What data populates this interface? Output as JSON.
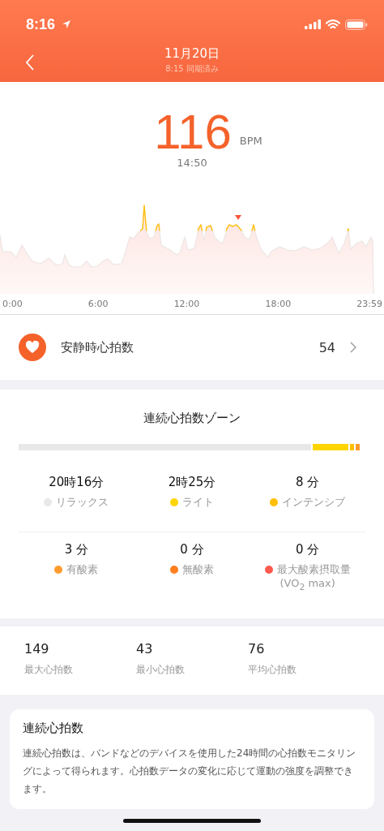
{
  "status_bar": {
    "time": "8:16"
  },
  "nav": {
    "title": "11月20日",
    "subtitle": "8:15 同期済み"
  },
  "current": {
    "value": "116",
    "unit": "BPM",
    "time": "14:50"
  },
  "graph": {
    "axis_labels": [
      "0:00",
      "6:00",
      "12:00",
      "18:00",
      "23:59"
    ]
  },
  "resting": {
    "label": "安静時心拍数",
    "value": "54"
  },
  "zones": {
    "title": "連続心拍数ゾーン",
    "items": [
      {
        "duration": "20時16分",
        "label": "リラックス",
        "color": "#e8e8e8"
      },
      {
        "duration": "2時25分",
        "label": "ライト",
        "color": "#ffd500"
      },
      {
        "duration": "8 分",
        "label": "インテンシブ",
        "color": "#ffbe00"
      },
      {
        "duration": "3 分",
        "label": "有酸素",
        "color": "#ff9b2d"
      },
      {
        "duration": "0 分",
        "label": "無酸素",
        "color": "#ff7f1e"
      },
      {
        "duration": "0 分",
        "label": "最大酸素摂取量",
        "note": "(VO$_{2}$ max)",
        "color": "#ff5a4e"
      }
    ]
  },
  "stats": [
    {
      "value": "149",
      "label": "最大心拍数"
    },
    {
      "value": "43",
      "label": "最小心拍数"
    },
    {
      "value": "76",
      "label": "平均心拍数"
    }
  ],
  "info": {
    "title": "連続心拍数",
    "text": "連続心拍数は、バンドなどのデバイスを使用した24時間の心拍数モニタリングによって得られます。心拍数データの変化に応じて運動の強度を調整できます。"
  }
}
